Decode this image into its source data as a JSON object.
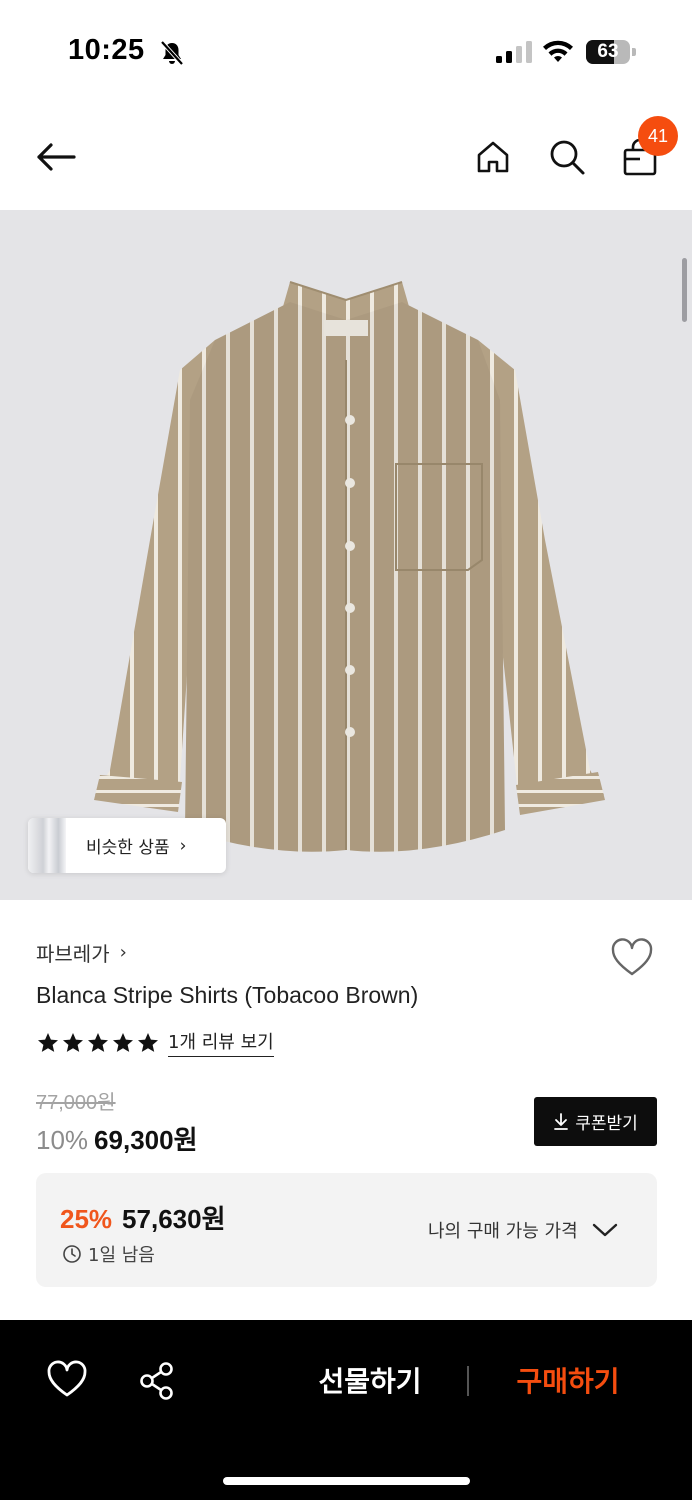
{
  "status_bar": {
    "time": "10:25",
    "battery": "63",
    "battery_level": 0.63
  },
  "nav": {
    "cart_count": "41"
  },
  "similar": {
    "label": "비슷한 상품",
    "chevron": "›"
  },
  "product": {
    "brand": "파브레가",
    "brand_chevron": "›",
    "name": "Blanca Stripe Shirts (Tobacoo Brown)",
    "rating": 5,
    "review_link": "1개 리뷰 보기",
    "original_price": "77,000원",
    "discount": "10%",
    "price": "69,300원"
  },
  "coupon": {
    "label": "쿠폰받기"
  },
  "best_price": {
    "discount": "25%",
    "price": "57,630원",
    "time_left": "1일 남음",
    "link": "나의 구매 가능 가격"
  },
  "bottom_bar": {
    "gift": "선물하기",
    "buy": "구매하기"
  },
  "colors": {
    "accent": "#f54d0f",
    "best_discount": "#f0561c",
    "shirt": "#b3a185",
    "image_bg": "#e4e4e7"
  },
  "icons": [
    "bell-slash-icon",
    "signal-icon",
    "wifi-icon",
    "back-arrow-icon",
    "home-icon",
    "search-icon",
    "shopping-bag-icon",
    "heart-icon",
    "star-icon",
    "download-icon",
    "clock-icon",
    "chevron-down-icon",
    "share-icon"
  ]
}
